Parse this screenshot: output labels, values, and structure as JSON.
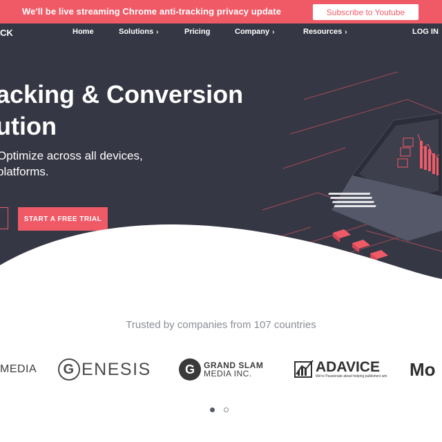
{
  "announcement": {
    "text": "We'll be live streaming Chrome anti-tracking privacy update",
    "button_label": "Subscribe to Youtube"
  },
  "nav": {
    "logo_fragment": "CK",
    "items": [
      {
        "label": "Home",
        "has_chevron": false
      },
      {
        "label": "Solutions",
        "has_chevron": true
      },
      {
        "label": "Pricing",
        "has_chevron": false
      },
      {
        "label": "Company",
        "has_chevron": true
      },
      {
        "label": "Resources",
        "has_chevron": true
      }
    ],
    "login_label": "LOG IN",
    "chevron_glyph": "›"
  },
  "hero": {
    "title_line1": "acking & Conversion",
    "title_line2": "ution",
    "subtitle_line1": "Optimize across all devices,",
    "subtitle_line2": "platforms.",
    "cta_primary": "START A FREE TRIAL"
  },
  "trusted": {
    "heading": "Trusted by companies from 107 countries",
    "logos": {
      "media": "MEDIA",
      "genesis_g": "G",
      "genesis_rest": "ENESIS",
      "grand_slam_g": "G",
      "grand_slam_line1": "GRAND SLAM",
      "grand_slam_line2": "MEDIA INC.",
      "adavice": "ADAVICE",
      "adavice_tagline": "We're Passionate about helping publishers win",
      "mo": "Mo"
    }
  },
  "carousel": {
    "dots": 2,
    "active_index": 0
  },
  "colors": {
    "accent": "#f05a67",
    "hero_bg": "#363744",
    "muted_text": "#8a8d96"
  },
  "icons": [
    "chevron-right-icon",
    "laptop-chart-illustration",
    "adavice-chart-icon"
  ]
}
